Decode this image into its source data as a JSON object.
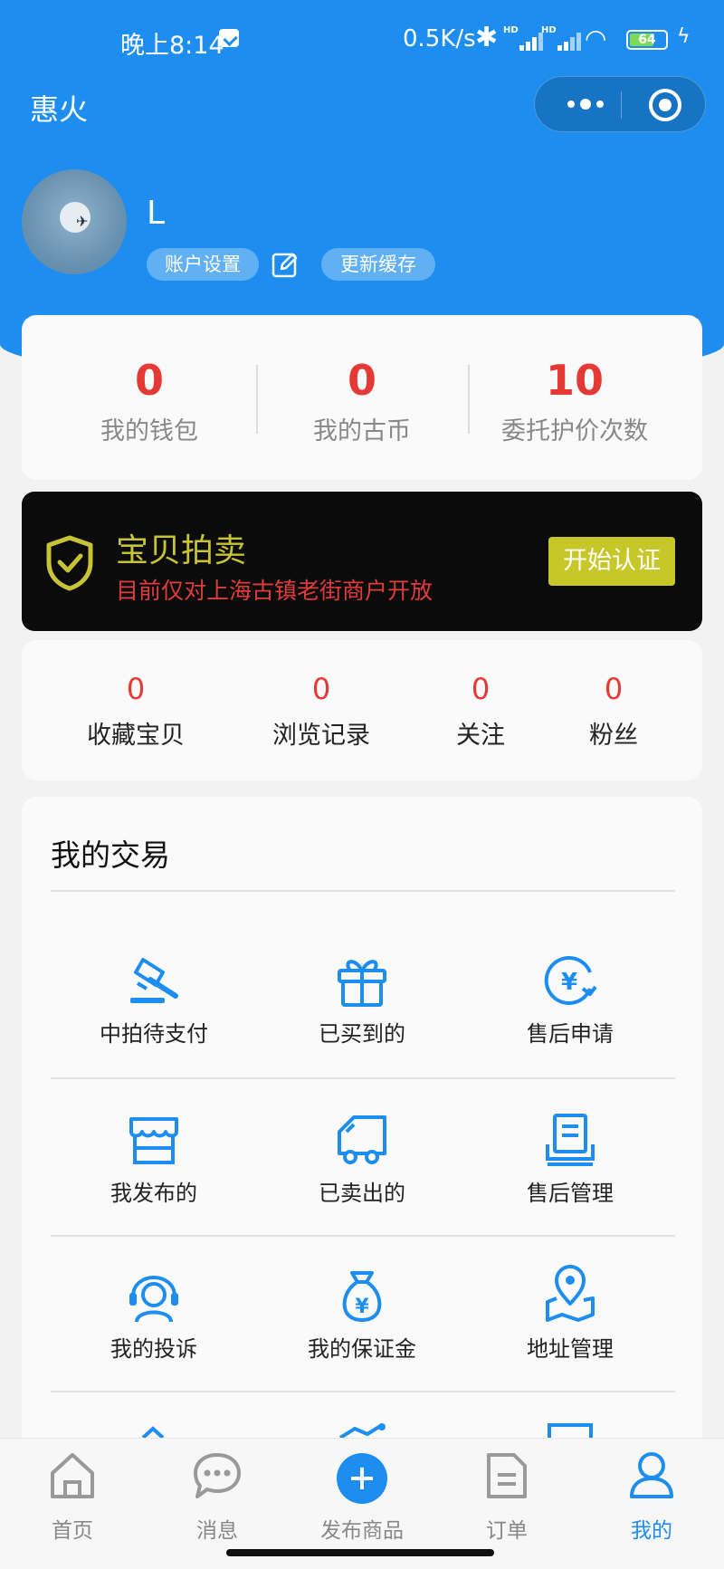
{
  "status_bar": {
    "time": "晚上8:14",
    "net_speed": "0.5K/s",
    "battery": "64",
    "hd1": "HD",
    "hd2": "HD"
  },
  "app": {
    "title": "惠火"
  },
  "profile": {
    "name": "L",
    "account_settings": "账户设置",
    "refresh_cache": "更新缓存"
  },
  "stats": [
    {
      "value": "0",
      "label": "我的钱包"
    },
    {
      "value": "0",
      "label": "我的古币"
    },
    {
      "value": "10",
      "label": "委托护价次数"
    }
  ],
  "auction": {
    "title": "宝贝拍卖",
    "subtitle": "目前仅对上海古镇老街商户开放",
    "button": "开始认证",
    "title_color": "#c6c334",
    "subtitle_color": "#e03b3b"
  },
  "counts": [
    {
      "value": "0",
      "label": "收藏宝贝"
    },
    {
      "value": "0",
      "label": "浏览记录"
    },
    {
      "value": "0",
      "label": "关注"
    },
    {
      "value": "0",
      "label": "粉丝"
    }
  ],
  "trades": {
    "title": "我的交易",
    "items": [
      {
        "label": "中拍待支付",
        "icon": "auction-hammer-icon"
      },
      {
        "label": "已买到的",
        "icon": "gift-icon"
      },
      {
        "label": "售后申请",
        "icon": "yen-refund-icon"
      },
      {
        "label": "我发布的",
        "icon": "store-icon"
      },
      {
        "label": "已卖出的",
        "icon": "truck-icon"
      },
      {
        "label": "售后管理",
        "icon": "document-stack-icon"
      },
      {
        "label": "我的投诉",
        "icon": "headset-icon"
      },
      {
        "label": "我的保证金",
        "icon": "money-bag-icon"
      },
      {
        "label": "地址管理",
        "icon": "map-pin-icon"
      }
    ]
  },
  "tabs": [
    {
      "label": "首页",
      "icon": "home-icon"
    },
    {
      "label": "消息",
      "icon": "chat-icon"
    },
    {
      "label": "发布商品",
      "icon": "plus-icon"
    },
    {
      "label": "订单",
      "icon": "order-icon"
    },
    {
      "label": "我的",
      "icon": "user-icon",
      "active": true
    }
  ],
  "colors": {
    "primary": "#1d8ef0",
    "stat_red": "#e53935"
  }
}
